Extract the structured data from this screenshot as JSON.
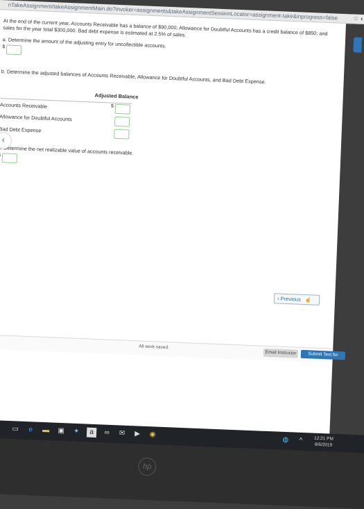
{
  "browser": {
    "url": "nTakeAssignment/takeAssignmentMain.do?invoker=assignments&takeAssignmentSessionLocator=assignment-take&inprogress=false"
  },
  "question": {
    "intro": "At the end of the current year, Accounts Receivable has a balance of $90,000; Allowance for Doubtful Accounts has a credit balance of $850; and sales for the year total $300,000. Bad debt expense is estimated at 2.5% of sales.",
    "part_a": "a. Determine the amount of the adjusting entry for uncollectible accounts.",
    "part_b": "b. Determine the adjusted balances of Accounts Receivable, Allowance for Doubtful Accounts, and Bad Debt Expense.",
    "part_c": "c. Determine the net realizable value of accounts receivable.",
    "currency_symbol": "$",
    "table": {
      "column_header": "Adjusted Balance",
      "rows": [
        "Accounts Receivable",
        "Allowance for Doubtful Accounts",
        "Bad Debt Expense"
      ]
    }
  },
  "nav": {
    "previous_label": "Previous"
  },
  "footer": {
    "saved_text": "All work saved.",
    "email_label": "Email Instructor",
    "submit_label": "Submit Test for Grading"
  },
  "taskbar": {
    "time": "12:21 PM",
    "date": "8/6/2019"
  },
  "icons": {
    "side_arrow": "chevron-left-icon",
    "previous": "chevron-left-icon",
    "cursor": "hand-pointer-icon",
    "taskbar": [
      "windows-icon",
      "task-view-icon",
      "edge-icon",
      "file-explorer-icon",
      "store-icon",
      "app-icon",
      "amazon-icon",
      "link-icon",
      "mail-icon",
      "media-icon",
      "chrome-icon"
    ]
  },
  "colors": {
    "accent": "#2d76b7",
    "input_border": "#8fcf8f",
    "taskbar": "#202327"
  }
}
